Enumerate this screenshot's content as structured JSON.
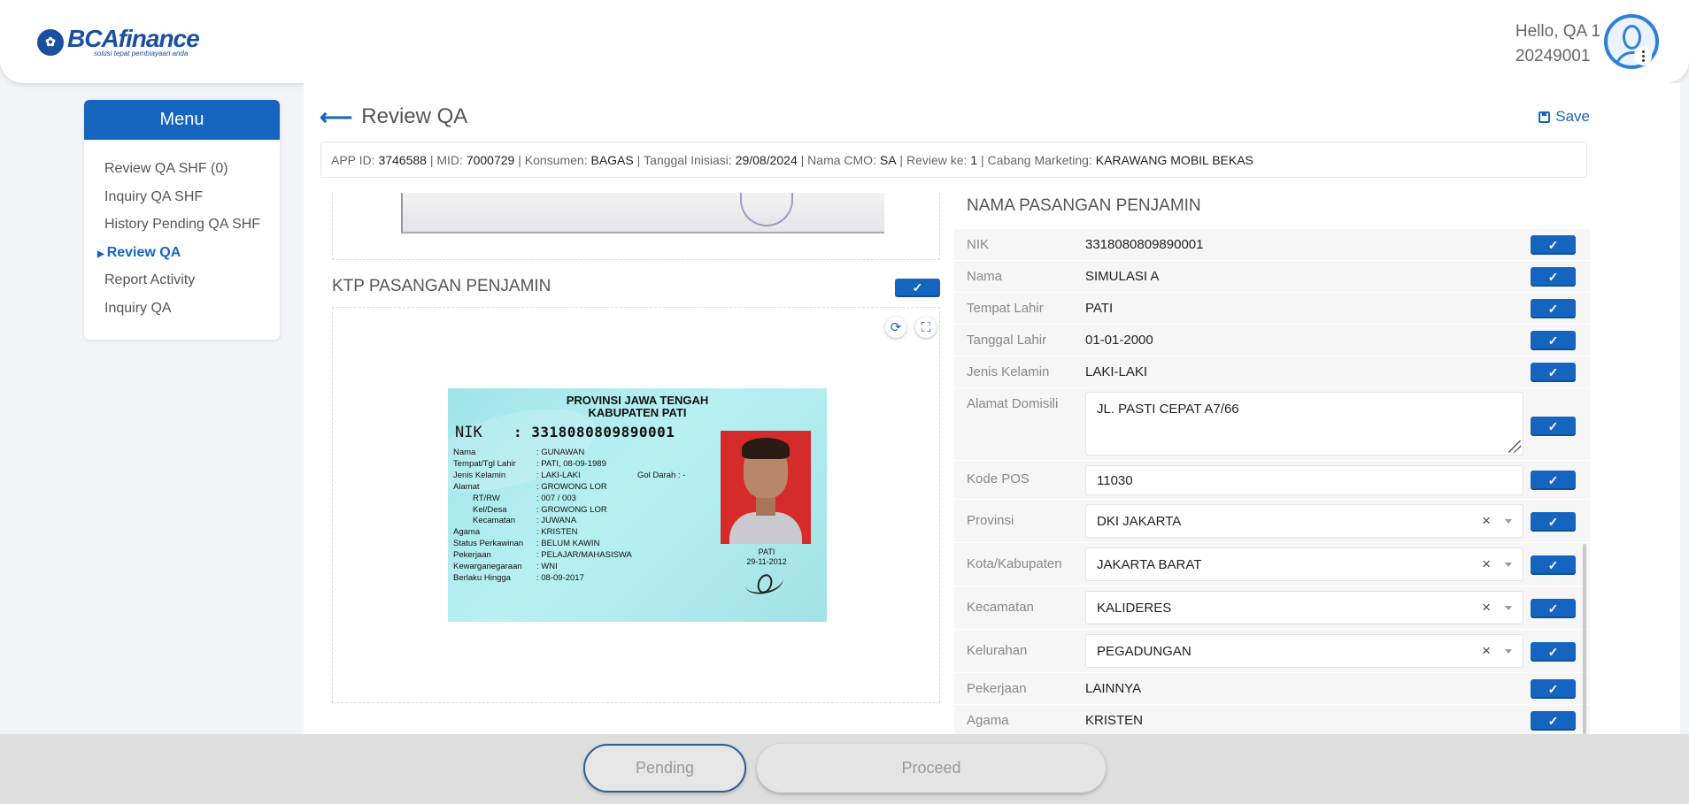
{
  "header": {
    "logo_emblem": "✿",
    "logo_text": "BCAfinance",
    "logo_tagline": "solusi tepat pembiayaan anda",
    "greeting": "Hello, QA 1",
    "user_id": "20249001"
  },
  "sidebar": {
    "title": "Menu",
    "items": [
      {
        "label": "Review QA SHF (0)"
      },
      {
        "label": "Inquiry QA SHF"
      },
      {
        "label": "History Pending QA SHF"
      },
      {
        "label": "Review QA"
      },
      {
        "label": "Report Activity"
      },
      {
        "label": "Inquiry QA"
      }
    ],
    "active_index": 3
  },
  "page": {
    "back_icon": "arrow-left-icon",
    "title": "Review QA",
    "save_label": "Save"
  },
  "info_bar": {
    "app_id_label": "APP ID:",
    "app_id": "3746588",
    "mid_label": "MID:",
    "mid": "7000729",
    "konsumen_label": "Konsumen:",
    "konsumen": "BAGAS",
    "tanggal_label": "Tanggal Inisiasi:",
    "tanggal": "29/08/2024",
    "cmo_label": "Nama CMO:",
    "cmo": "SA",
    "review_label": "Review ke:",
    "review": "1",
    "cabang_label": "Cabang Marketing:",
    "cabang": "KARAWANG MOBIL BEKAS"
  },
  "ktp_section": {
    "title": "KTP PASANGAN PENJAMIN",
    "card": {
      "province": "PROVINSI JAWA TENGAH",
      "regency": "KABUPATEN PATI",
      "nik_label": "NIK",
      "nik": ": 3318080809890001",
      "rows": [
        {
          "k": "Nama",
          "v": ": GUNAWAN"
        },
        {
          "k": "Tempat/Tgl Lahir",
          "v": ": PATI, 08-09-1989"
        },
        {
          "k": "Jenis Kelamin",
          "v": ": LAKI-LAKI"
        },
        {
          "k": "Alamat",
          "v": ": GROWONG LOR"
        },
        {
          "k": "    RT/RW",
          "v": ": 007 / 003"
        },
        {
          "k": "    Kel/Desa",
          "v": ": GROWONG LOR"
        },
        {
          "k": "    Kecamatan",
          "v": ": JUWANA"
        },
        {
          "k": "Agama",
          "v": ": KRISTEN"
        },
        {
          "k": "Status Perkawinan",
          "v": ": BELUM KAWIN"
        },
        {
          "k": "Pekerjaan",
          "v": ": PELAJAR/MAHASISWA"
        },
        {
          "k": "Kewarganegaraan",
          "v": ": WNI"
        },
        {
          "k": "Berlaku Hingga",
          "v": ": 08-09-2017"
        }
      ],
      "gol_darah": "Gol Darah  : -",
      "place": "PATI",
      "issued": "29-11-2012"
    }
  },
  "form": {
    "title": "NAMA PASANGAN PENJAMIN",
    "nik_label": "NIK",
    "nik": "3318080809890001",
    "nama_label": "Nama",
    "nama": "SIMULASI A",
    "tempat_label": "Tempat Lahir",
    "tempat": "PATI",
    "tanggal_label": "Tanggal Lahir",
    "tanggal": "01-01-2000",
    "jk_label": "Jenis Kelamin",
    "jk": "LAKI-LAKI",
    "alamat_label": "Alamat Domisili",
    "alamat": "JL. PASTI CEPAT A7/66",
    "kodepos_label": "Kode POS",
    "kodepos": "11030",
    "provinsi_label": "Provinsi",
    "provinsi": "DKI JAKARTA",
    "kota_label": "Kota/Kabupaten",
    "kota": "JAKARTA BARAT",
    "kecamatan_label": "Kecamatan",
    "kecamatan": "KALIDERES",
    "kelurahan_label": "Kelurahan",
    "kelurahan": "PEGADUNGAN",
    "pekerjaan_label": "Pekerjaan",
    "pekerjaan": "LAINNYA",
    "agama_label": "Agama",
    "agama": "KRISTEN",
    "clear_glyph": "×",
    "check_glyph": "✓"
  },
  "footer": {
    "pending_label": "Pending",
    "proceed_label": "Proceed"
  },
  "colors": {
    "primary": "#1565c0",
    "background": "#f2f4f8"
  }
}
